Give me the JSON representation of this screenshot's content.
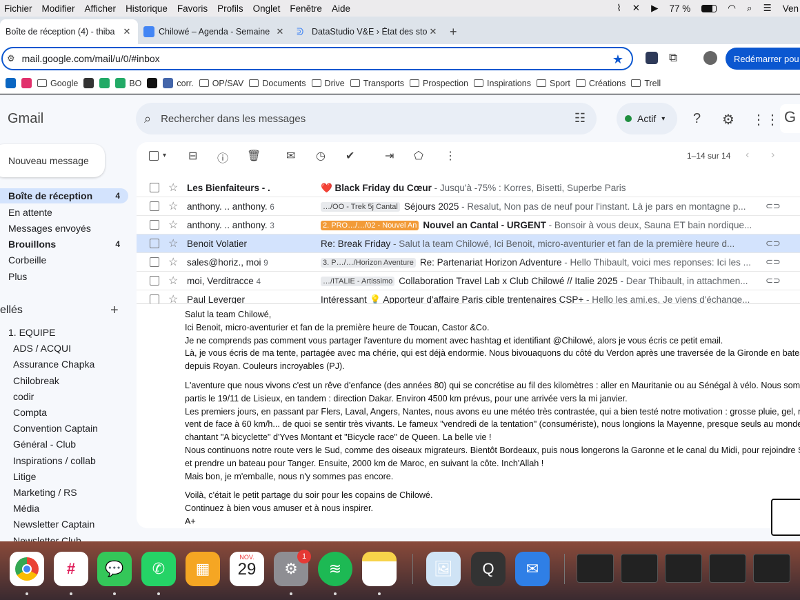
{
  "menubar": {
    "items": [
      "Fichier",
      "Modifier",
      "Afficher",
      "Historique",
      "Favoris",
      "Profils",
      "Onglet",
      "Fenêtre",
      "Aide"
    ],
    "battery": "77 %",
    "clock": "Ven"
  },
  "tabs": [
    {
      "label": "Boîte de réception (4) - thiba",
      "icon": "gmail-icon",
      "active": true
    },
    {
      "label": "Chilowé – Agenda - Semaine",
      "icon": "calendar-icon",
      "active": false
    },
    {
      "label": "DataStudio V&E › État des sto",
      "icon": "datastudio-icon",
      "active": false
    }
  ],
  "toolbar": {
    "url": "mail.google.com/mail/u/0/#inbox",
    "restart": "Redémarrer pou"
  },
  "bookmarks": [
    {
      "label": "",
      "icon": "linkedin-icon",
      "color": "#0a66c2"
    },
    {
      "label": "",
      "icon": "instagram-icon",
      "color": "#e1306c"
    },
    {
      "label": "Google",
      "icon": "folder-icon"
    },
    {
      "label": "",
      "icon": "site-icon",
      "color": "#333"
    },
    {
      "label": "",
      "icon": "site-icon",
      "color": "#2a6"
    },
    {
      "label": "BO",
      "icon": "site-icon",
      "color": "#2a6"
    },
    {
      "label": "",
      "icon": "openai-icon",
      "color": "#111"
    },
    {
      "label": "corr.",
      "icon": "site-icon",
      "color": "#46a"
    },
    {
      "label": "OP/SAV",
      "icon": "folder-icon"
    },
    {
      "label": "Documents",
      "icon": "folder-icon"
    },
    {
      "label": "Drive",
      "icon": "folder-icon"
    },
    {
      "label": "Transports",
      "icon": "folder-icon"
    },
    {
      "label": "Prospection",
      "icon": "folder-icon"
    },
    {
      "label": "Inspirations",
      "icon": "folder-icon"
    },
    {
      "label": "Sport",
      "icon": "folder-icon"
    },
    {
      "label": "Créations",
      "icon": "folder-icon"
    },
    {
      "label": "Trell",
      "icon": "folder-icon"
    }
  ],
  "gmail": {
    "logo": "Gmail",
    "search_placeholder": "Rechercher dans les messages",
    "status": "Actif",
    "compose": "Nouveau message",
    "nav": [
      {
        "label": "Boîte de réception",
        "count": "4",
        "selected": true
      },
      {
        "label": "En attente",
        "count": "",
        "selected": false
      },
      {
        "label": "Messages envoyés",
        "count": "",
        "selected": false
      },
      {
        "label": "Brouillons",
        "count": "4",
        "selected": false,
        "bold": true
      },
      {
        "label": "Corbeille",
        "count": "",
        "selected": false
      },
      {
        "label": "Plus",
        "count": "",
        "selected": false
      }
    ],
    "labels_title": "ellés",
    "labels": [
      "1. EQUIPE",
      "ADS / ACQUI",
      "Assurance Chapka",
      "Chilobreak",
      "codir",
      "Compta",
      "Convention Captain",
      "Général - Club",
      "Inspirations / collab",
      "Litige",
      "Marketing / RS",
      "Média",
      "Newsletter Captain",
      "Newsletter Club"
    ],
    "paging": "1–14 sur 14",
    "rows": [
      {
        "sender": "Les Bienfaiteurs - .",
        "count": "",
        "tag": "",
        "tag_color": "",
        "subject": "❤️ Black Friday du Cœur",
        "snippet": " - Jusqu'à -75% : Korres, Bisetti, Superbe Paris",
        "clip": false,
        "unread": true,
        "selected": false
      },
      {
        "sender": "anthony. .. anthony.",
        "count": "6",
        "tag": "…/OO - Trek 5j Cantal",
        "tag_color": "#e8eaed",
        "subject": "Séjours 2025",
        "snippet": " - Resalut, Non pas de neuf pour l'instant. Là je pars en montagne p...",
        "clip": true,
        "unread": false,
        "selected": false
      },
      {
        "sender": "anthony. .. anthony.",
        "count": "3",
        "tag": "2. PRO…/…/02 - Nouvel An",
        "tag_color": "#f29b38",
        "subject": "Nouvel an Cantal - URGENT",
        "snippet": " - Bonsoir à vous deux, Sauna ET bain nordique...",
        "clip": false,
        "unread": false,
        "selected": false
      },
      {
        "sender": "Benoit Volatier",
        "count": "",
        "tag": "",
        "tag_color": "",
        "subject": "Re: Break Friday",
        "snippet": " - Salut la team Chilowé, Ici Benoit, micro-aventurier et fan de la première heure d...",
        "clip": true,
        "unread": false,
        "selected": true
      },
      {
        "sender": "sales@horiz., moi",
        "count": "9",
        "tag": "3. P…/…/Horizon Aventure",
        "tag_color": "#e8eaed",
        "subject": "Re: Partenariat Horizon Adventure",
        "snippet": " - Hello Thibault, voici mes reponses: Ici les ...",
        "clip": true,
        "unread": false,
        "selected": false
      },
      {
        "sender": "moi, Verditracce",
        "count": "4",
        "tag": "…/ITALIE - Artissimo",
        "tag_color": "#e8eaed",
        "subject": "Collaboration Travel Lab x Club Chilowé // Italie 2025",
        "snippet": " - Dear Thibault, in attachmen...",
        "clip": true,
        "unread": false,
        "selected": false
      },
      {
        "sender": "Paul Leverger",
        "count": "",
        "tag": "",
        "tag_color": "",
        "subject": "Intéressant 💡 Apporteur d'affaire Paris cible trentenaires CSP+",
        "snippet": " - Hello les ami.es, Je viens d'échange...",
        "clip": false,
        "unread": false,
        "selected": false
      }
    ],
    "message": [
      "Salut la team Chilowé,",
      "Ici Benoit, micro-aventurier et fan de la première heure de Toucan, Castor &Co.",
      "Je ne comprends pas comment vous partager l'aventure du moment avec hashtag et identifiant @Chilowé, alors je vous écris ce petit email.",
      "Là, je vous écris de ma tente, partagée avec ma chérie, qui est déjà endormie. Nous bivouaquons du côté du Verdon après une traversée de la Gironde en batea",
      "depuis Royan. Couleurs incroyables (PJ).",
      "",
      "L'aventure que nous vivons c'est un rêve d'enfance (des années 80) qui se concrétise au fil des kilomètres : aller en Mauritanie ou au Sénégal à vélo. Nous somm",
      "partis le 19/11 de Lisieux, en tandem : direction Dakar. Environ 4500 km prévus, pour une arrivée vers la mi janvier.",
      "Les premiers jours, en passant par Flers, Laval, Angers, Nantes, nous avons eu une météo très contrastée, qui a bien testé notre motivation : grosse pluie, gel, n",
      "vent de face à 60 km/h... de quoi se sentir très vivants. Le fameux \"vendredi de la tentation\" (consumériste), nous longions la Mayenne, presque seuls au monde",
      "chantant \"A bicyclette\" d'Yves Montant et \"Bicycle race\" de Queen. La belle vie !",
      "Nous continuons notre route vers le Sud, comme des oiseaux migrateurs. Bientôt Bordeaux, puis nous longerons la Garonne et le canal du Midi, pour rejoindre S",
      "et prendre un bateau pour Tanger. Ensuite, 2000 km de Maroc, en suivant la côte. Inch'Allah !",
      "Mais bon, je m'emballe, nous n'y sommes pas encore.",
      "",
      "Voilà, c'était le petit partage du soir pour les copains de Chilowé.",
      "Continuez à bien vous amuser et à nous inspirer.",
      "A+"
    ]
  },
  "dock": {
    "calendar_month": "NOV.",
    "calendar_day": "29",
    "settings_badge": "1",
    "apps": [
      "chrome-icon",
      "slack-icon",
      "messages-icon",
      "whatsapp-icon",
      "calculator-icon",
      "calendar-icon",
      "settings-icon",
      "spotify-icon",
      "notes-icon",
      "preview-icon",
      "quicktime-icon",
      "mail-icon"
    ]
  }
}
